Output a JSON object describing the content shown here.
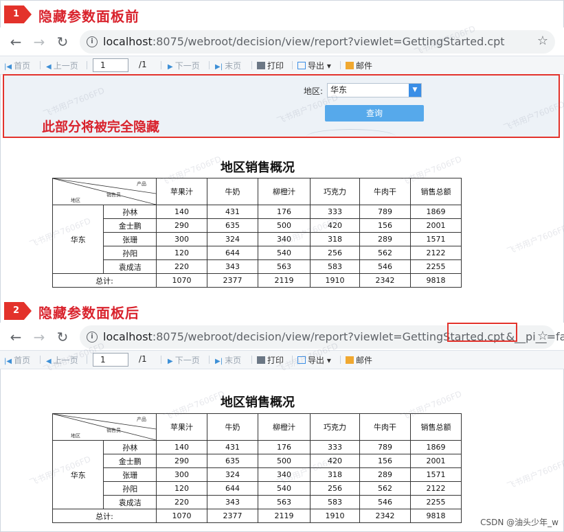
{
  "step1": {
    "number": "1",
    "title": "隐藏参数面板前"
  },
  "step2": {
    "number": "2",
    "title": "隐藏参数面板后"
  },
  "browser1": {
    "url_host": "localhost",
    "url_rest": ":8075/webroot/decision/view/report?viewlet=GettingStarted.cpt",
    "url_param": ""
  },
  "browser2": {
    "url_host": "localhost",
    "url_rest": ":8075/webroot/decision/view/report?viewlet=GettingStarted.cpt",
    "url_param": "&__pi__=false"
  },
  "toolbar": {
    "first": "首页",
    "prev": "上一页",
    "page_value": "1",
    "page_total": "/1",
    "next": "下一页",
    "last": "末页",
    "print": "打印",
    "export": "导出",
    "mail": "邮件"
  },
  "param_panel": {
    "label": "地区:",
    "select_value": "华东",
    "query_button": "查询",
    "note": "此部分将被完全隐藏"
  },
  "report": {
    "title": "地区销售概况",
    "header_corner": {
      "product": "产品",
      "salesperson": "销售员",
      "region": "地区"
    },
    "columns": [
      "苹果汁",
      "牛奶",
      "柳橙汁",
      "巧克力",
      "牛肉干",
      "销售总额"
    ],
    "region": "华东",
    "rows": [
      {
        "name": "孙林",
        "values": [
          "140",
          "431",
          "176",
          "333",
          "789",
          "1869"
        ]
      },
      {
        "name": "金士鹏",
        "values": [
          "290",
          "635",
          "500",
          "420",
          "156",
          "2001"
        ]
      },
      {
        "name": "张珊",
        "values": [
          "300",
          "324",
          "340",
          "318",
          "289",
          "1571"
        ]
      },
      {
        "name": "孙阳",
        "values": [
          "120",
          "644",
          "540",
          "256",
          "562",
          "2122"
        ]
      },
      {
        "name": "袁成洁",
        "values": [
          "220",
          "343",
          "563",
          "583",
          "546",
          "2255"
        ]
      }
    ],
    "total_label": "总计:",
    "totals": [
      "1070",
      "2377",
      "2119",
      "1910",
      "2342",
      "9818"
    ]
  },
  "watermark": "飞书用户7606FD",
  "credit": "CSDN @油头少年_w",
  "colors": {
    "accent_red": "#e3322b",
    "query_blue": "#56a9eb",
    "panel_bg": "#edf2f7"
  }
}
